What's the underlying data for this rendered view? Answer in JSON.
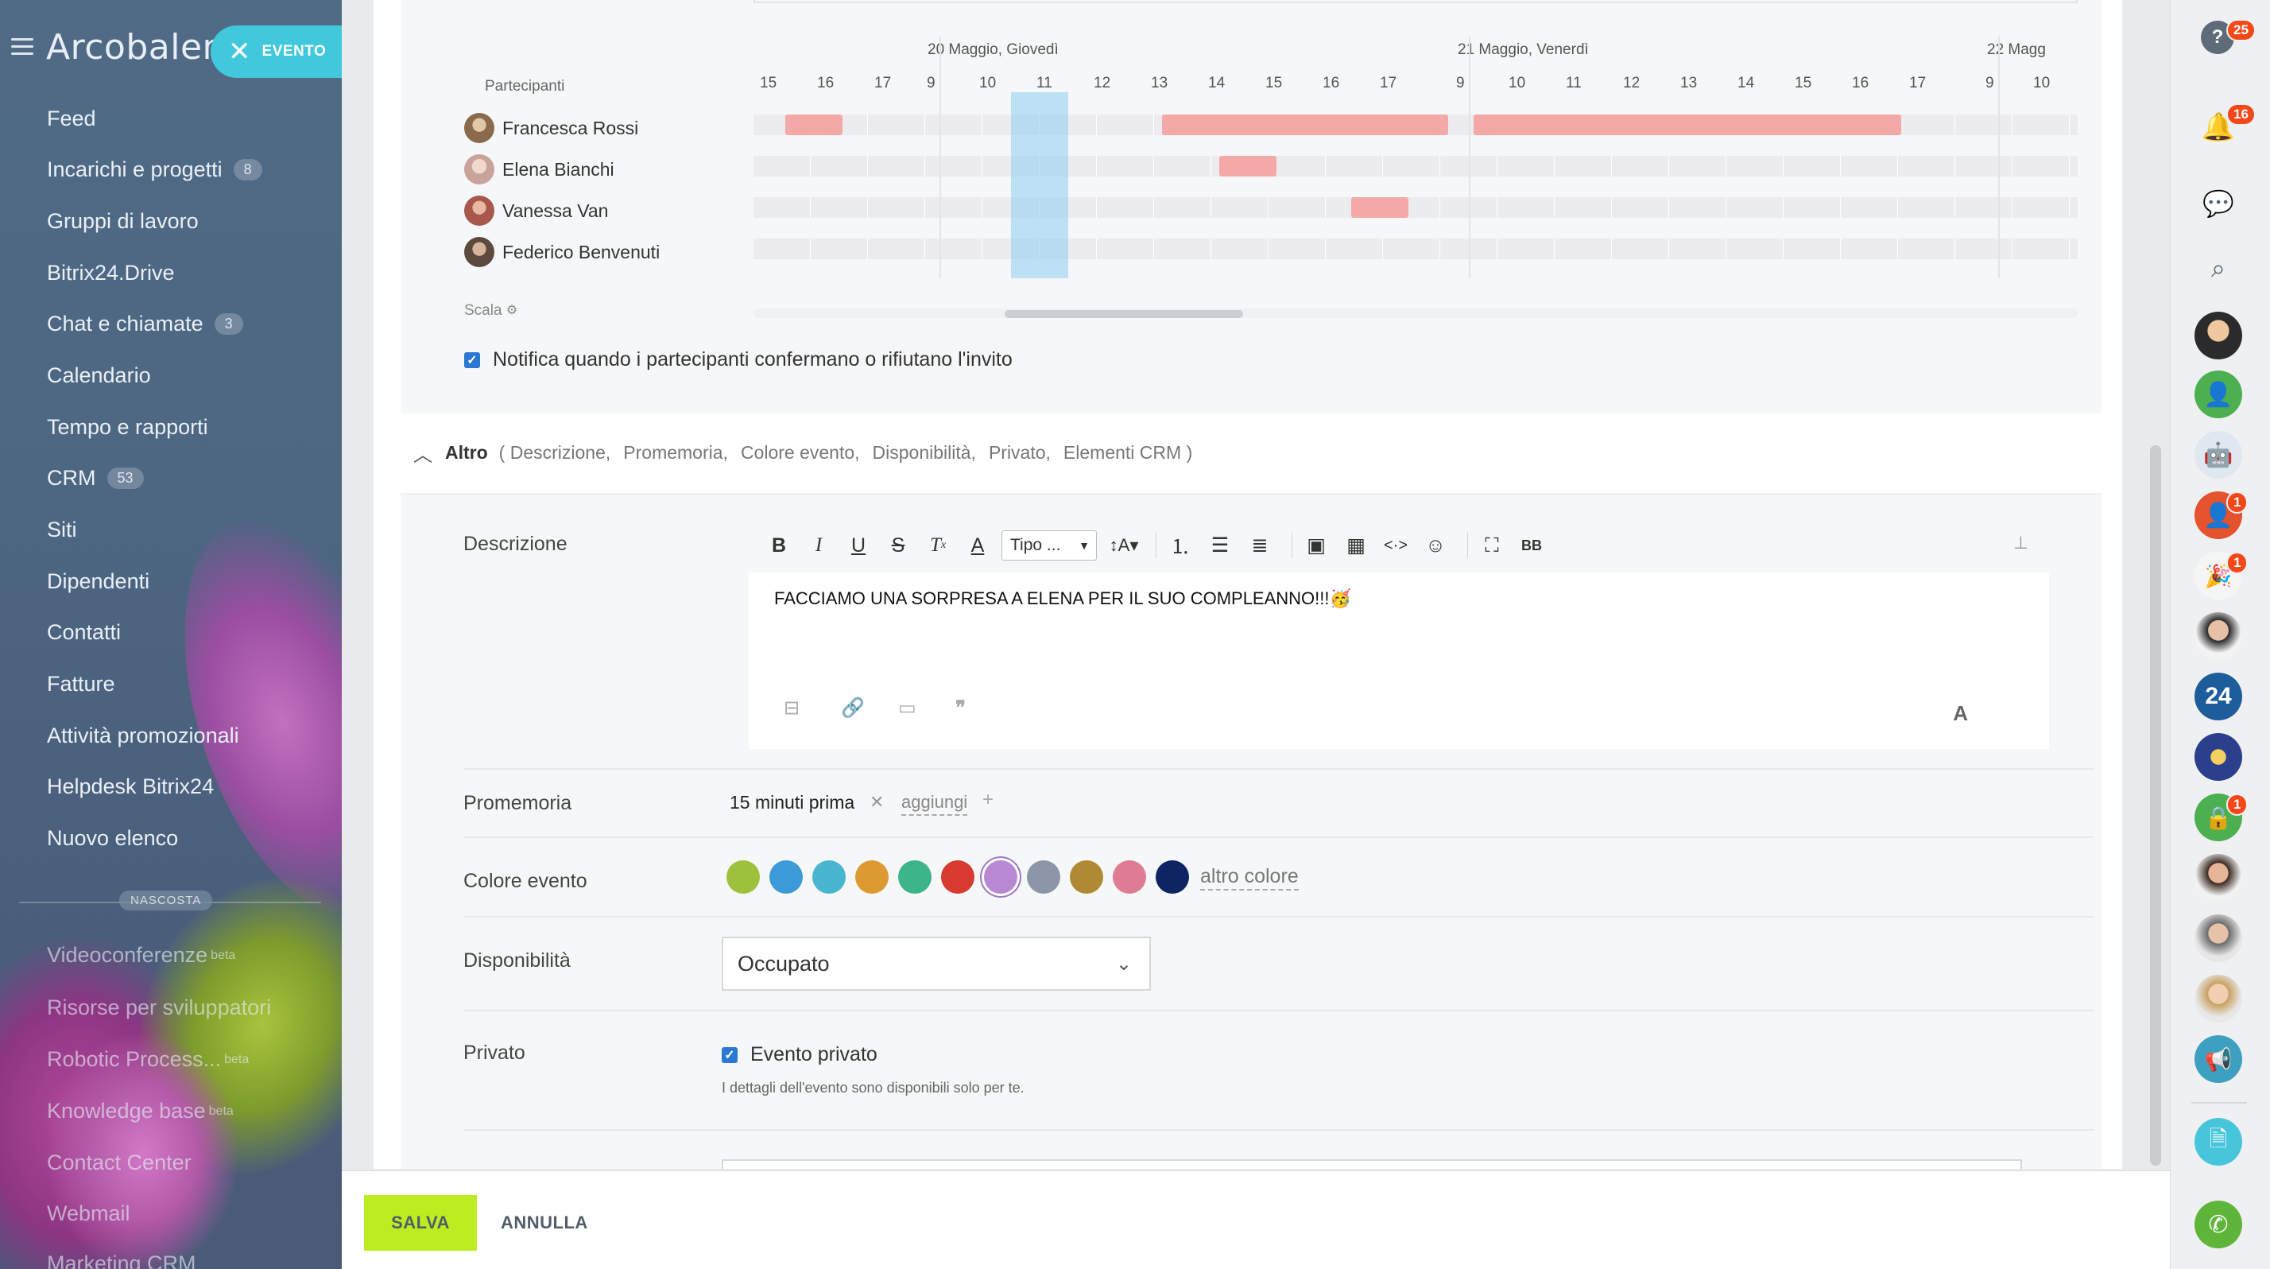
{
  "sidebar": {
    "brand": "Arcobalen",
    "evento_pill": "EVENTO",
    "items": [
      {
        "label": "Feed",
        "count": ""
      },
      {
        "label": "Incarichi e progetti",
        "count": "8"
      },
      {
        "label": "Gruppi di lavoro",
        "count": ""
      },
      {
        "label": "Bitrix24.Drive",
        "count": ""
      },
      {
        "label": "Chat e chiamate",
        "count": "3"
      },
      {
        "label": "Calendario",
        "count": ""
      },
      {
        "label": "Tempo e rapporti",
        "count": ""
      },
      {
        "label": "CRM",
        "count": "53"
      },
      {
        "label": "Siti",
        "count": ""
      },
      {
        "label": "Dipendenti",
        "count": ""
      },
      {
        "label": "Contatti",
        "count": ""
      },
      {
        "label": "Fatture",
        "count": ""
      },
      {
        "label": "Attività promozionali",
        "count": ""
      },
      {
        "label": "Helpdesk Bitrix24",
        "count": ""
      },
      {
        "label": "Nuovo elenco",
        "count": ""
      }
    ],
    "hidden_label": "NASCOSTA",
    "hidden_items": [
      {
        "label": "Videoconferenze",
        "suffix": "beta"
      },
      {
        "label": "Risorse per sviluppatori",
        "suffix": ""
      },
      {
        "label": "Robotic Process...",
        "suffix": "beta"
      },
      {
        "label": "Knowledge base",
        "suffix": "beta"
      },
      {
        "label": "Contact Center",
        "suffix": ""
      },
      {
        "label": "Webmail",
        "suffix": ""
      },
      {
        "label": "Marketing CRM",
        "suffix": ""
      }
    ]
  },
  "planner": {
    "participants_label": "Partecipanti",
    "days": [
      {
        "label": "20 Maggio, Giovedì"
      },
      {
        "label": "21 Maggio, Venerdì"
      },
      {
        "label": "22 Magg"
      }
    ],
    "hours_day0": [
      "15",
      "16",
      "17"
    ],
    "hours_day1": [
      "9",
      "10",
      "11",
      "12",
      "13",
      "14",
      "15",
      "16",
      "17"
    ],
    "hours_day2": [
      "9",
      "10",
      "11",
      "12",
      "13",
      "14",
      "15",
      "16",
      "17"
    ],
    "hours_day3": [
      "9",
      "10"
    ],
    "participants": [
      {
        "name": "Francesca Rossi",
        "avatar_color": "#8a6a4a"
      },
      {
        "name": "Elena Bianchi",
        "avatar_color": "#c9a39a"
      },
      {
        "name": "Vanessa Van",
        "avatar_color": "#a8574a"
      },
      {
        "name": "Federico Benvenuti",
        "avatar_color": "#5c4a3e"
      }
    ],
    "scale_label": "Scala",
    "notify_label": "Notifica quando i partecipanti confermano o rifiutano l'invito"
  },
  "altro": {
    "title": "Altro",
    "links": [
      "( Descrizione,",
      "Promemoria,",
      "Colore evento,",
      "Disponibilità,",
      "Privato,",
      "Elementi CRM )"
    ]
  },
  "description": {
    "label": "Descrizione",
    "tipo_label": "Tipo ...",
    "text": "FACCIAMO UNA SORPRESA A ELENA PER IL SUO COMPLEANNO!!!🥳",
    "font_icon": "A"
  },
  "reminder": {
    "label": "Promemoria",
    "value": "15 minuti prima",
    "add_label": "aggiungi"
  },
  "color": {
    "label": "Colore evento",
    "swatches": [
      "#9dc13c",
      "#3b9ad7",
      "#48b6cf",
      "#dd9a32",
      "#3db58a",
      "#d73b2f",
      "#b888d4",
      "#8c96a6",
      "#b08a32",
      "#df7c93",
      "#0f2462"
    ],
    "selected_index": 6,
    "other_label": "altro colore"
  },
  "availability": {
    "label": "Disponibilità",
    "value": "Occupato"
  },
  "private": {
    "label": "Privato",
    "checkbox_label": "Evento privato",
    "note": "I dettagli dell'evento sono disponibili solo per te."
  },
  "footer": {
    "save": "SALVA",
    "cancel": "ANNULLA"
  },
  "rightbar": {
    "help_badge": "25",
    "notif_badge": "16",
    "contact_badge_1": "1",
    "contact_badge_2": "1",
    "contact_badge_3": "1",
    "b24_label": "24"
  }
}
